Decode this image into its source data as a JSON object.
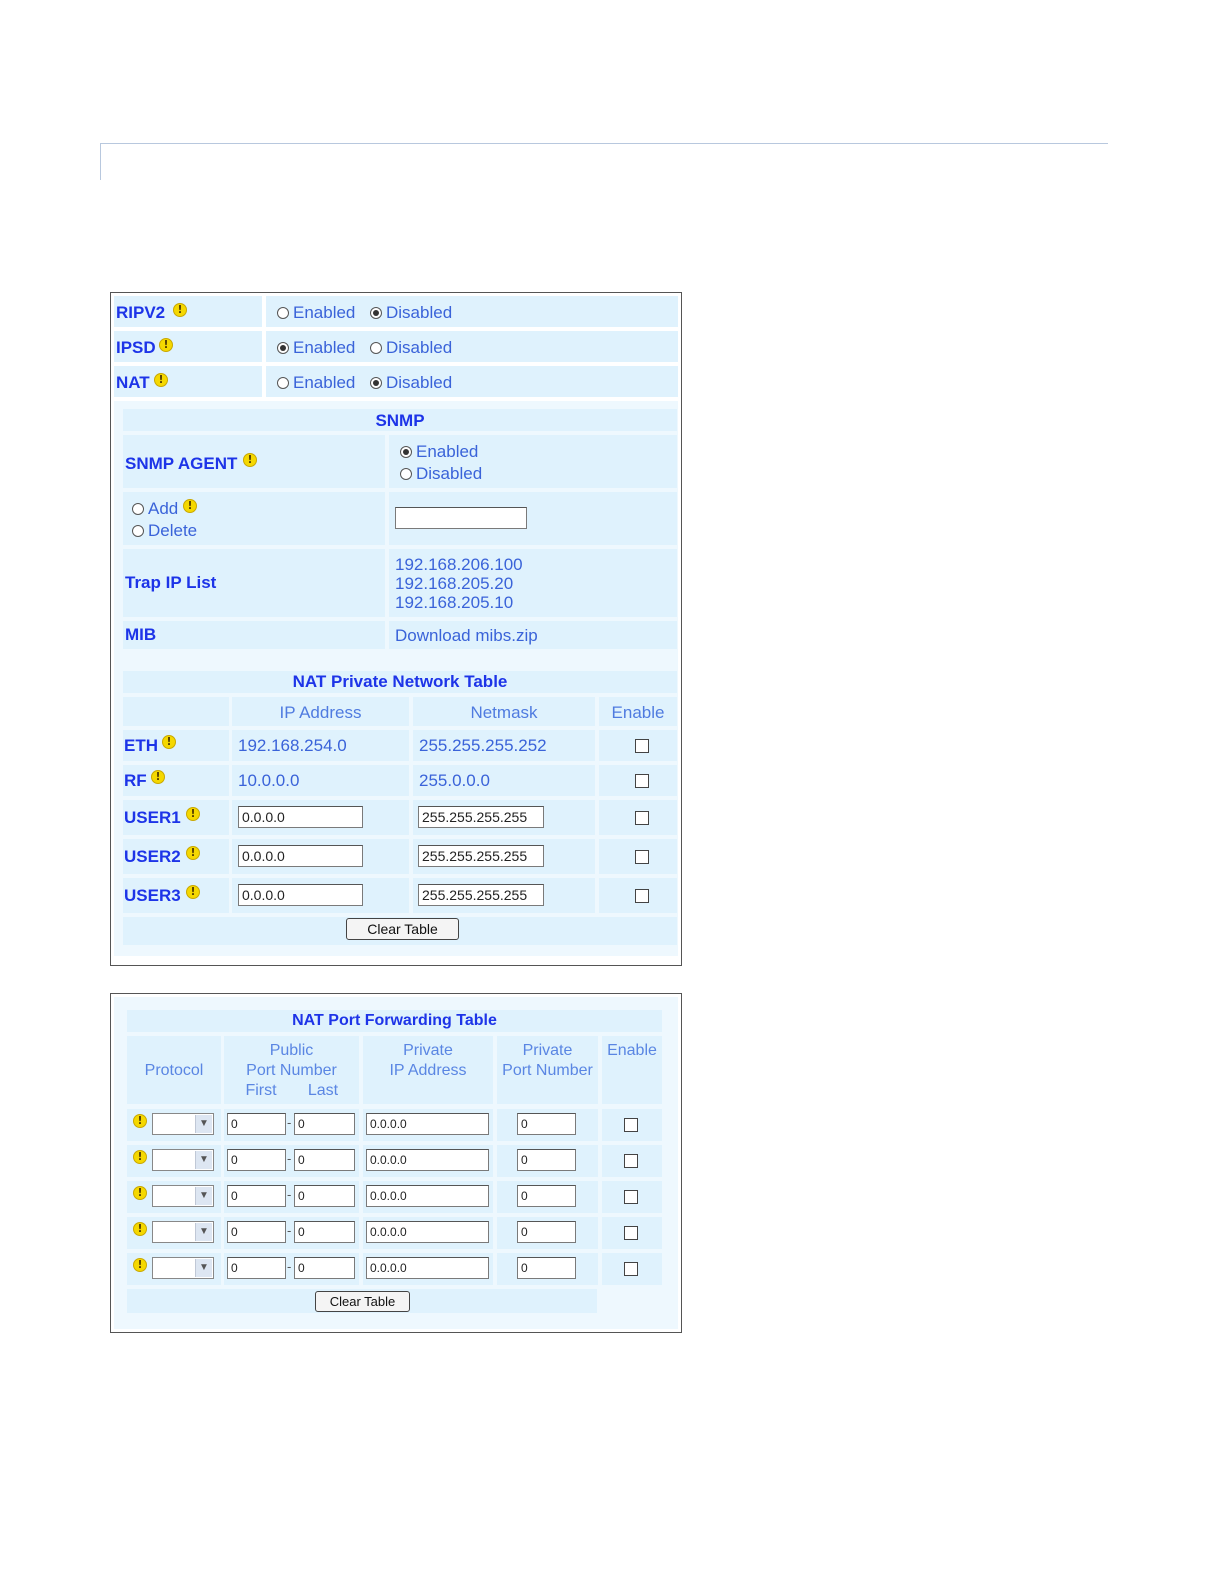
{
  "global": {
    "rows": [
      {
        "label": "RIPV2",
        "enabled_label": "Enabled",
        "disabled_label": "Disabled",
        "selected": "Disabled"
      },
      {
        "label": "IPSD",
        "enabled_label": "Enabled",
        "disabled_label": "Disabled",
        "selected": "Enabled"
      },
      {
        "label": "NAT",
        "enabled_label": "Enabled",
        "disabled_label": "Disabled",
        "selected": "Disabled"
      }
    ]
  },
  "snmp": {
    "title": "SNMP",
    "agent_label": "SNMP AGENT",
    "agent_enabled": "Enabled",
    "agent_disabled": "Disabled",
    "agent_selected": "Enabled",
    "add_label": "Add",
    "delete_label": "Delete",
    "ip_input_value": "",
    "trap_label": "Trap IP List",
    "trap_ips": [
      "192.168.206.100",
      "192.168.205.20",
      "192.168.205.10"
    ],
    "mib_label": "MIB",
    "mib_link": "Download mibs.zip"
  },
  "nat_private": {
    "title": "NAT Private Network Table",
    "col_ip": "IP Address",
    "col_netmask": "Netmask",
    "col_enable": "Enable",
    "rows": [
      {
        "label": "ETH",
        "ip": "192.168.254.0",
        "netmask": "255.255.255.252",
        "editable": false
      },
      {
        "label": "RF",
        "ip": "10.0.0.0",
        "netmask": "255.0.0.0",
        "editable": false
      },
      {
        "label": "USER1",
        "ip": "0.0.0.0",
        "netmask": "255.255.255.255",
        "editable": true
      },
      {
        "label": "USER2",
        "ip": "0.0.0.0",
        "netmask": "255.255.255.255",
        "editable": true
      },
      {
        "label": "USER3",
        "ip": "0.0.0.0",
        "netmask": "255.255.255.255",
        "editable": true
      }
    ],
    "clear_button": "Clear Table"
  },
  "nat_port": {
    "title": "NAT Port Forwarding Table",
    "col_protocol": "Protocol",
    "col_public_1": "Public",
    "col_public_2": "Port Number",
    "col_first": "First",
    "col_last": "Last",
    "col_private_ip_1": "Private",
    "col_private_ip_2": "IP Address",
    "col_private_port_1": "Private",
    "col_private_port_2": "Port Number",
    "col_enable": "Enable",
    "rows": [
      {
        "first": "0",
        "dash": "-",
        "last": "0",
        "private_ip": "0.0.0.0",
        "private_port": "0"
      },
      {
        "first": "0",
        "dash": "-",
        "last": "0",
        "private_ip": "0.0.0.0",
        "private_port": "0"
      },
      {
        "first": "0",
        "dash": "-",
        "last": "0",
        "private_ip": "0.0.0.0",
        "private_port": "0"
      },
      {
        "first": "0",
        "dash": "-",
        "last": "0",
        "private_ip": "0.0.0.0",
        "private_port": "0"
      },
      {
        "first": "0",
        "dash": "-",
        "last": "0",
        "private_ip": "0.0.0.0",
        "private_port": "0"
      }
    ],
    "clear_button": "Clear Table"
  }
}
